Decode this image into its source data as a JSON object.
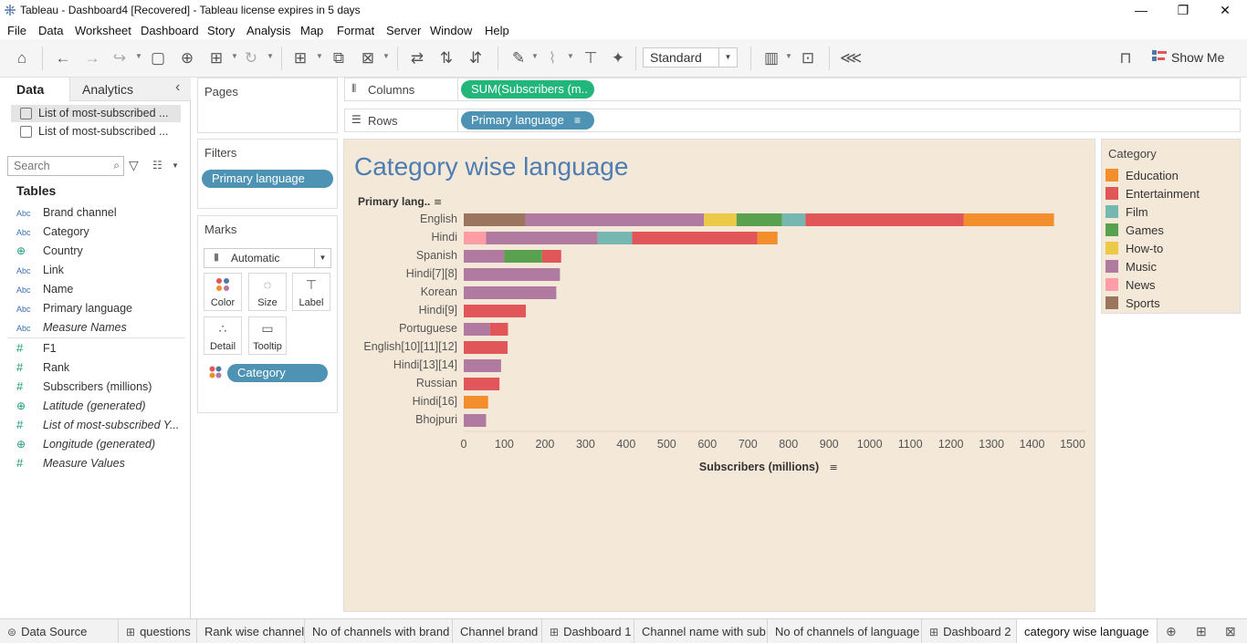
{
  "window": {
    "title": "Tableau - Dashboard4 [Recovered] - Tableau license expires in 5 days",
    "minimize": "—",
    "restore": "❐",
    "close": "✕"
  },
  "menu": [
    "File",
    "Data",
    "Worksheet",
    "Dashboard",
    "Story",
    "Analysis",
    "Map",
    "Format",
    "Server",
    "Window",
    "Help"
  ],
  "toolbar": {
    "fit_value": "Standard",
    "show_me_label": "Show Me"
  },
  "left_pane": {
    "tab_data": "Data",
    "tab_analytics": "Analytics",
    "collapse_glyph": "‹",
    "datasources": [
      "List of most-subscribed ...",
      "List of most-subscribed ..."
    ],
    "search_placeholder": "Search",
    "tables_heading": "Tables",
    "dimensions": [
      {
        "type": "Abc",
        "name": "Brand channel"
      },
      {
        "type": "Abc",
        "name": "Category"
      },
      {
        "type": "globe",
        "name": "Country"
      },
      {
        "type": "Abc",
        "name": "Link"
      },
      {
        "type": "Abc",
        "name": "Name"
      },
      {
        "type": "Abc",
        "name": "Primary language"
      },
      {
        "type": "Abc",
        "name": "Measure Names"
      }
    ],
    "measures": [
      {
        "type": "#",
        "name": "F1"
      },
      {
        "type": "#",
        "name": "Rank"
      },
      {
        "type": "#",
        "name": "Subscribers (millions)"
      },
      {
        "type": "globe",
        "name": "Latitude (generated)"
      },
      {
        "type": "#",
        "name": "List of most-subscribed Y..."
      },
      {
        "type": "globe",
        "name": "Longitude (generated)"
      },
      {
        "type": "#",
        "name": "Measure Values"
      }
    ]
  },
  "cards": {
    "pages_title": "Pages",
    "filters_title": "Filters",
    "filter_pill": "Primary language",
    "marks_title": "Marks",
    "marks_type": "Automatic",
    "mark_buttons": [
      "Color",
      "Size",
      "Label",
      "Detail",
      "Tooltip"
    ],
    "marks_pill": "Category"
  },
  "shelves": {
    "columns_label": "Columns",
    "columns_pill": "SUM(Subscribers (m..",
    "rows_label": "Rows",
    "rows_pill": "Primary language"
  },
  "legend": {
    "title": "Category",
    "items": [
      {
        "name": "Education",
        "color": "#f28e2b"
      },
      {
        "name": "Entertainment",
        "color": "#e15759"
      },
      {
        "name": "Film",
        "color": "#76b7b2"
      },
      {
        "name": "Games",
        "color": "#59a14f"
      },
      {
        "name": "How-to",
        "color": "#edc948"
      },
      {
        "name": "Music",
        "color": "#b07aa1"
      },
      {
        "name": "News",
        "color": "#ff9da7"
      },
      {
        "name": "Sports",
        "color": "#9c755f"
      }
    ]
  },
  "chart_data": {
    "type": "bar",
    "orientation": "horizontal-stacked",
    "title": "Category wise language",
    "row_header": "Primary lang..",
    "xlabel": "Subscribers (millions)",
    "xlim": [
      0,
      1500
    ],
    "xticks": [
      0,
      100,
      200,
      300,
      400,
      500,
      600,
      700,
      800,
      900,
      1000,
      1100,
      1200,
      1300,
      1400,
      1500
    ],
    "categories": [
      "English",
      "Hindi",
      "Spanish",
      "Hindi[7][8]",
      "Korean",
      "Hindi[9]",
      "Portuguese",
      "English[10][11][12]",
      "Hindi[13][14]",
      "Russian",
      "Hindi[16]",
      "Bhojpuri"
    ],
    "series_order": [
      "Sports",
      "News",
      "Music",
      "How-to",
      "Games",
      "Film",
      "Entertainment",
      "Education"
    ],
    "stacks": [
      [
        {
          "s": "Sports",
          "v": 152
        },
        {
          "s": "Music",
          "v": 440
        },
        {
          "s": "How-to",
          "v": 80
        },
        {
          "s": "Games",
          "v": 112
        },
        {
          "s": "Film",
          "v": 58
        },
        {
          "s": "Entertainment",
          "v": 390
        },
        {
          "s": "Education",
          "v": 222
        }
      ],
      [
        {
          "s": "News",
          "v": 55
        },
        {
          "s": "Music",
          "v": 275
        },
        {
          "s": "Film",
          "v": 85
        },
        {
          "s": "Entertainment",
          "v": 308
        },
        {
          "s": "Education",
          "v": 50
        }
      ],
      [
        {
          "s": "Music",
          "v": 100
        },
        {
          "s": "Games",
          "v": 93
        },
        {
          "s": "Entertainment",
          "v": 47
        }
      ],
      [
        {
          "s": "Music",
          "v": 237
        }
      ],
      [
        {
          "s": "Music",
          "v": 228
        }
      ],
      [
        {
          "s": "Entertainment",
          "v": 153
        }
      ],
      [
        {
          "s": "Music",
          "v": 65
        },
        {
          "s": "Entertainment",
          "v": 44
        }
      ],
      [
        {
          "s": "Entertainment",
          "v": 108
        }
      ],
      [
        {
          "s": "Music",
          "v": 92
        }
      ],
      [
        {
          "s": "Entertainment",
          "v": 88
        }
      ],
      [
        {
          "s": "Education",
          "v": 60
        }
      ],
      [
        {
          "s": "Music",
          "v": 55
        }
      ]
    ]
  },
  "bottom_tabs": [
    {
      "label": "Data Source",
      "icon": "datasource",
      "active": false
    },
    {
      "label": "questions",
      "icon": "grid",
      "active": false
    },
    {
      "label": "Rank wise channel",
      "icon": "",
      "active": false
    },
    {
      "label": "No of channels with brand",
      "icon": "",
      "active": false
    },
    {
      "label": "Channel brand",
      "icon": "",
      "active": false
    },
    {
      "label": "Dashboard 1",
      "icon": "grid",
      "active": false
    },
    {
      "label": "Channel name with sub",
      "icon": "",
      "active": false
    },
    {
      "label": "No of channels of language",
      "icon": "",
      "active": false
    },
    {
      "label": "Dashboard 2",
      "icon": "grid",
      "active": false
    },
    {
      "label": "category wise language",
      "icon": "",
      "active": true
    }
  ]
}
